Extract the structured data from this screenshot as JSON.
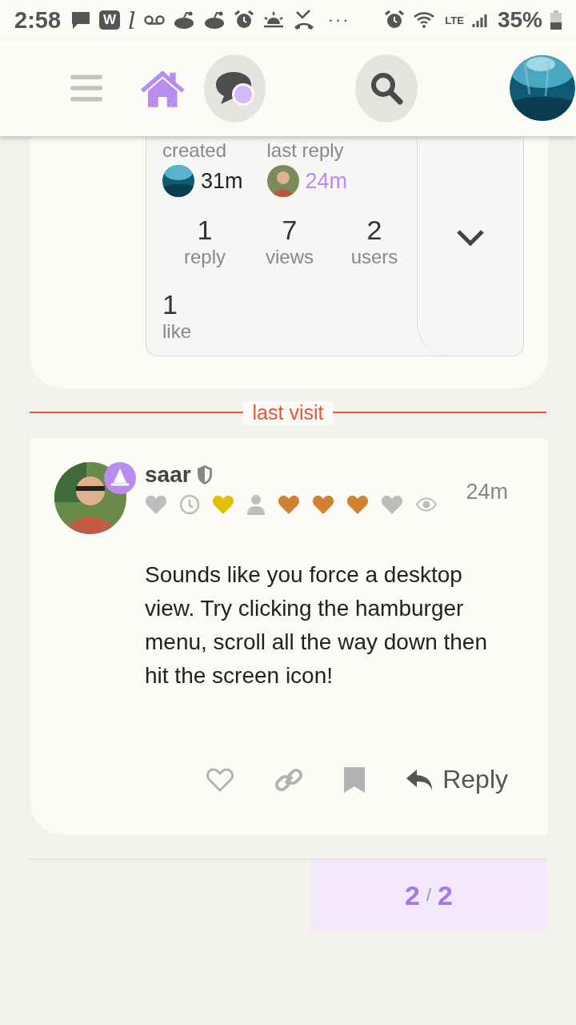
{
  "status_bar": {
    "time": "2:58",
    "w_badge": "W",
    "script_letter": "l",
    "more": "···",
    "network": "LTE",
    "battery": "35%"
  },
  "topic_stats": {
    "created": {
      "label": "created",
      "time": "31m"
    },
    "last_reply": {
      "label": "last reply",
      "time": "24m"
    },
    "counts": [
      {
        "value": "1",
        "label": "reply"
      },
      {
        "value": "7",
        "label": "views"
      },
      {
        "value": "2",
        "label": "users"
      },
      {
        "value": "1",
        "label": "like"
      }
    ]
  },
  "divider": {
    "label": "last visit"
  },
  "post": {
    "username": "saar",
    "moderator": true,
    "time": "24m",
    "flair": [
      {
        "kind": "heart",
        "color": "#bdbdbd"
      },
      {
        "kind": "clock",
        "color": "#bdbdbd"
      },
      {
        "kind": "heart",
        "color": "#e2c000"
      },
      {
        "kind": "person",
        "color": "#bdbdbd"
      },
      {
        "kind": "heart",
        "color": "#d08230"
      },
      {
        "kind": "heart",
        "color": "#d08230"
      },
      {
        "kind": "heart",
        "color": "#d08230"
      },
      {
        "kind": "heart",
        "color": "#bdbdbd"
      },
      {
        "kind": "eye",
        "color": "#bdbdbd"
      }
    ],
    "body": "Sounds like you force a desktop view. Try clicking the hamburger menu, scroll all the way down then hit the screen icon!",
    "reply_label": "Reply"
  },
  "progress": {
    "current": "2",
    "separator": "/",
    "total": "2"
  }
}
